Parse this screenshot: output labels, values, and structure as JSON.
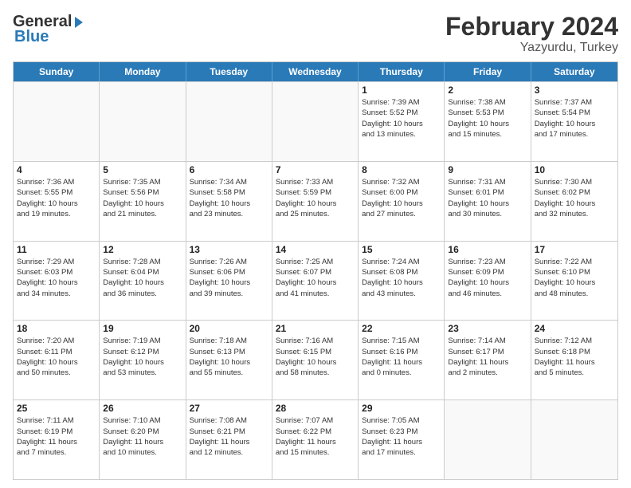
{
  "header": {
    "logo_general": "General",
    "logo_blue": "Blue",
    "month_title": "February 2024",
    "location": "Yazyurdu, Turkey"
  },
  "weekdays": [
    "Sunday",
    "Monday",
    "Tuesday",
    "Wednesday",
    "Thursday",
    "Friday",
    "Saturday"
  ],
  "rows": [
    [
      {
        "day": "",
        "info": ""
      },
      {
        "day": "",
        "info": ""
      },
      {
        "day": "",
        "info": ""
      },
      {
        "day": "",
        "info": ""
      },
      {
        "day": "1",
        "info": "Sunrise: 7:39 AM\nSunset: 5:52 PM\nDaylight: 10 hours\nand 13 minutes."
      },
      {
        "day": "2",
        "info": "Sunrise: 7:38 AM\nSunset: 5:53 PM\nDaylight: 10 hours\nand 15 minutes."
      },
      {
        "day": "3",
        "info": "Sunrise: 7:37 AM\nSunset: 5:54 PM\nDaylight: 10 hours\nand 17 minutes."
      }
    ],
    [
      {
        "day": "4",
        "info": "Sunrise: 7:36 AM\nSunset: 5:55 PM\nDaylight: 10 hours\nand 19 minutes."
      },
      {
        "day": "5",
        "info": "Sunrise: 7:35 AM\nSunset: 5:56 PM\nDaylight: 10 hours\nand 21 minutes."
      },
      {
        "day": "6",
        "info": "Sunrise: 7:34 AM\nSunset: 5:58 PM\nDaylight: 10 hours\nand 23 minutes."
      },
      {
        "day": "7",
        "info": "Sunrise: 7:33 AM\nSunset: 5:59 PM\nDaylight: 10 hours\nand 25 minutes."
      },
      {
        "day": "8",
        "info": "Sunrise: 7:32 AM\nSunset: 6:00 PM\nDaylight: 10 hours\nand 27 minutes."
      },
      {
        "day": "9",
        "info": "Sunrise: 7:31 AM\nSunset: 6:01 PM\nDaylight: 10 hours\nand 30 minutes."
      },
      {
        "day": "10",
        "info": "Sunrise: 7:30 AM\nSunset: 6:02 PM\nDaylight: 10 hours\nand 32 minutes."
      }
    ],
    [
      {
        "day": "11",
        "info": "Sunrise: 7:29 AM\nSunset: 6:03 PM\nDaylight: 10 hours\nand 34 minutes."
      },
      {
        "day": "12",
        "info": "Sunrise: 7:28 AM\nSunset: 6:04 PM\nDaylight: 10 hours\nand 36 minutes."
      },
      {
        "day": "13",
        "info": "Sunrise: 7:26 AM\nSunset: 6:06 PM\nDaylight: 10 hours\nand 39 minutes."
      },
      {
        "day": "14",
        "info": "Sunrise: 7:25 AM\nSunset: 6:07 PM\nDaylight: 10 hours\nand 41 minutes."
      },
      {
        "day": "15",
        "info": "Sunrise: 7:24 AM\nSunset: 6:08 PM\nDaylight: 10 hours\nand 43 minutes."
      },
      {
        "day": "16",
        "info": "Sunrise: 7:23 AM\nSunset: 6:09 PM\nDaylight: 10 hours\nand 46 minutes."
      },
      {
        "day": "17",
        "info": "Sunrise: 7:22 AM\nSunset: 6:10 PM\nDaylight: 10 hours\nand 48 minutes."
      }
    ],
    [
      {
        "day": "18",
        "info": "Sunrise: 7:20 AM\nSunset: 6:11 PM\nDaylight: 10 hours\nand 50 minutes."
      },
      {
        "day": "19",
        "info": "Sunrise: 7:19 AM\nSunset: 6:12 PM\nDaylight: 10 hours\nand 53 minutes."
      },
      {
        "day": "20",
        "info": "Sunrise: 7:18 AM\nSunset: 6:13 PM\nDaylight: 10 hours\nand 55 minutes."
      },
      {
        "day": "21",
        "info": "Sunrise: 7:16 AM\nSunset: 6:15 PM\nDaylight: 10 hours\nand 58 minutes."
      },
      {
        "day": "22",
        "info": "Sunrise: 7:15 AM\nSunset: 6:16 PM\nDaylight: 11 hours\nand 0 minutes."
      },
      {
        "day": "23",
        "info": "Sunrise: 7:14 AM\nSunset: 6:17 PM\nDaylight: 11 hours\nand 2 minutes."
      },
      {
        "day": "24",
        "info": "Sunrise: 7:12 AM\nSunset: 6:18 PM\nDaylight: 11 hours\nand 5 minutes."
      }
    ],
    [
      {
        "day": "25",
        "info": "Sunrise: 7:11 AM\nSunset: 6:19 PM\nDaylight: 11 hours\nand 7 minutes."
      },
      {
        "day": "26",
        "info": "Sunrise: 7:10 AM\nSunset: 6:20 PM\nDaylight: 11 hours\nand 10 minutes."
      },
      {
        "day": "27",
        "info": "Sunrise: 7:08 AM\nSunset: 6:21 PM\nDaylight: 11 hours\nand 12 minutes."
      },
      {
        "day": "28",
        "info": "Sunrise: 7:07 AM\nSunset: 6:22 PM\nDaylight: 11 hours\nand 15 minutes."
      },
      {
        "day": "29",
        "info": "Sunrise: 7:05 AM\nSunset: 6:23 PM\nDaylight: 11 hours\nand 17 minutes."
      },
      {
        "day": "",
        "info": ""
      },
      {
        "day": "",
        "info": ""
      }
    ]
  ]
}
